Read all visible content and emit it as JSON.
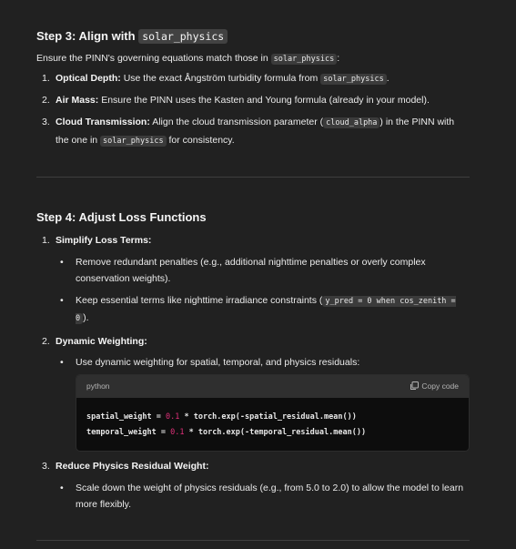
{
  "step3": {
    "title": "Step 3: Align with",
    "title_code": "solar_physics",
    "intro_pre": "Ensure the PINN's governing equations match those in",
    "intro_code": "solar_physics",
    "intro_post": ":",
    "items": [
      {
        "num": "1.",
        "label": "Optical Depth:",
        "text": "Use the exact Ångström turbidity formula from",
        "code": "solar_physics",
        "post": "."
      },
      {
        "num": "2.",
        "label": "Air Mass:",
        "text": "Ensure the PINN uses the Kasten and Young formula (already in your model)."
      },
      {
        "num": "3.",
        "label": "Cloud Transmission:",
        "text_pre": "Align the cloud transmission parameter (",
        "code": "cloud_alpha",
        "text_mid": ") in the PINN with the one in",
        "code2": "solar_physics",
        "text_post": "for consistency."
      }
    ]
  },
  "step4": {
    "title": "Step 4: Adjust Loss Functions",
    "item1": {
      "num": "1.",
      "label": "Simplify Loss Terms:",
      "bullets": [
        {
          "text": "Remove redundant penalties (e.g., additional nighttime penalties or overly complex conservation weights)."
        },
        {
          "text_pre": "Keep essential terms like nighttime irradiance constraints (",
          "code": "y_pred = 0 when cos_zenith = 0",
          "text_post": ")."
        }
      ]
    },
    "item2": {
      "num": "2.",
      "label": "Dynamic Weighting:",
      "bullet": "Use dynamic weighting for spatial, temporal, and physics residuals:",
      "code_lang": "python",
      "copy_label": "Copy code",
      "code_lines": [
        {
          "a": "spatial_weight = ",
          "n": "0.1",
          "b": " * torch.exp(-spatial_residual.mean())"
        },
        {
          "a": "temporal_weight = ",
          "n": "0.1",
          "b": " * torch.exp(-temporal_residual.mean())"
        }
      ]
    },
    "item3": {
      "num": "3.",
      "label": "Reduce Physics Residual Weight:",
      "bullet": "Scale down the weight of physics residuals (e.g., from 5.0 to 2.0) to allow the model to learn more flexibly."
    }
  }
}
